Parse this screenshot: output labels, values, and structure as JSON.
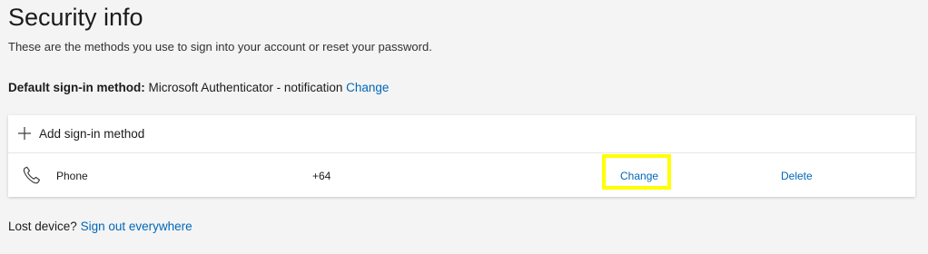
{
  "page": {
    "title": "Security info",
    "subtitle": "These are the methods you use to sign into your account or reset your password."
  },
  "default_method": {
    "label": "Default sign-in method:",
    "value": "Microsoft Authenticator - notification",
    "change_label": "Change"
  },
  "methods_card": {
    "add_label": "Add sign-in method",
    "add_icon": "plus-icon",
    "rows": [
      {
        "icon": "phone-icon",
        "type": "Phone",
        "value": "+64",
        "change_label": "Change",
        "delete_label": "Delete"
      }
    ]
  },
  "footer": {
    "lost_device_label": "Lost device?",
    "sign_out_label": "Sign out everywhere"
  },
  "colors": {
    "background": "#f4f4f4",
    "link": "#0067b8",
    "highlight": "#ffff00",
    "card": "#ffffff"
  }
}
